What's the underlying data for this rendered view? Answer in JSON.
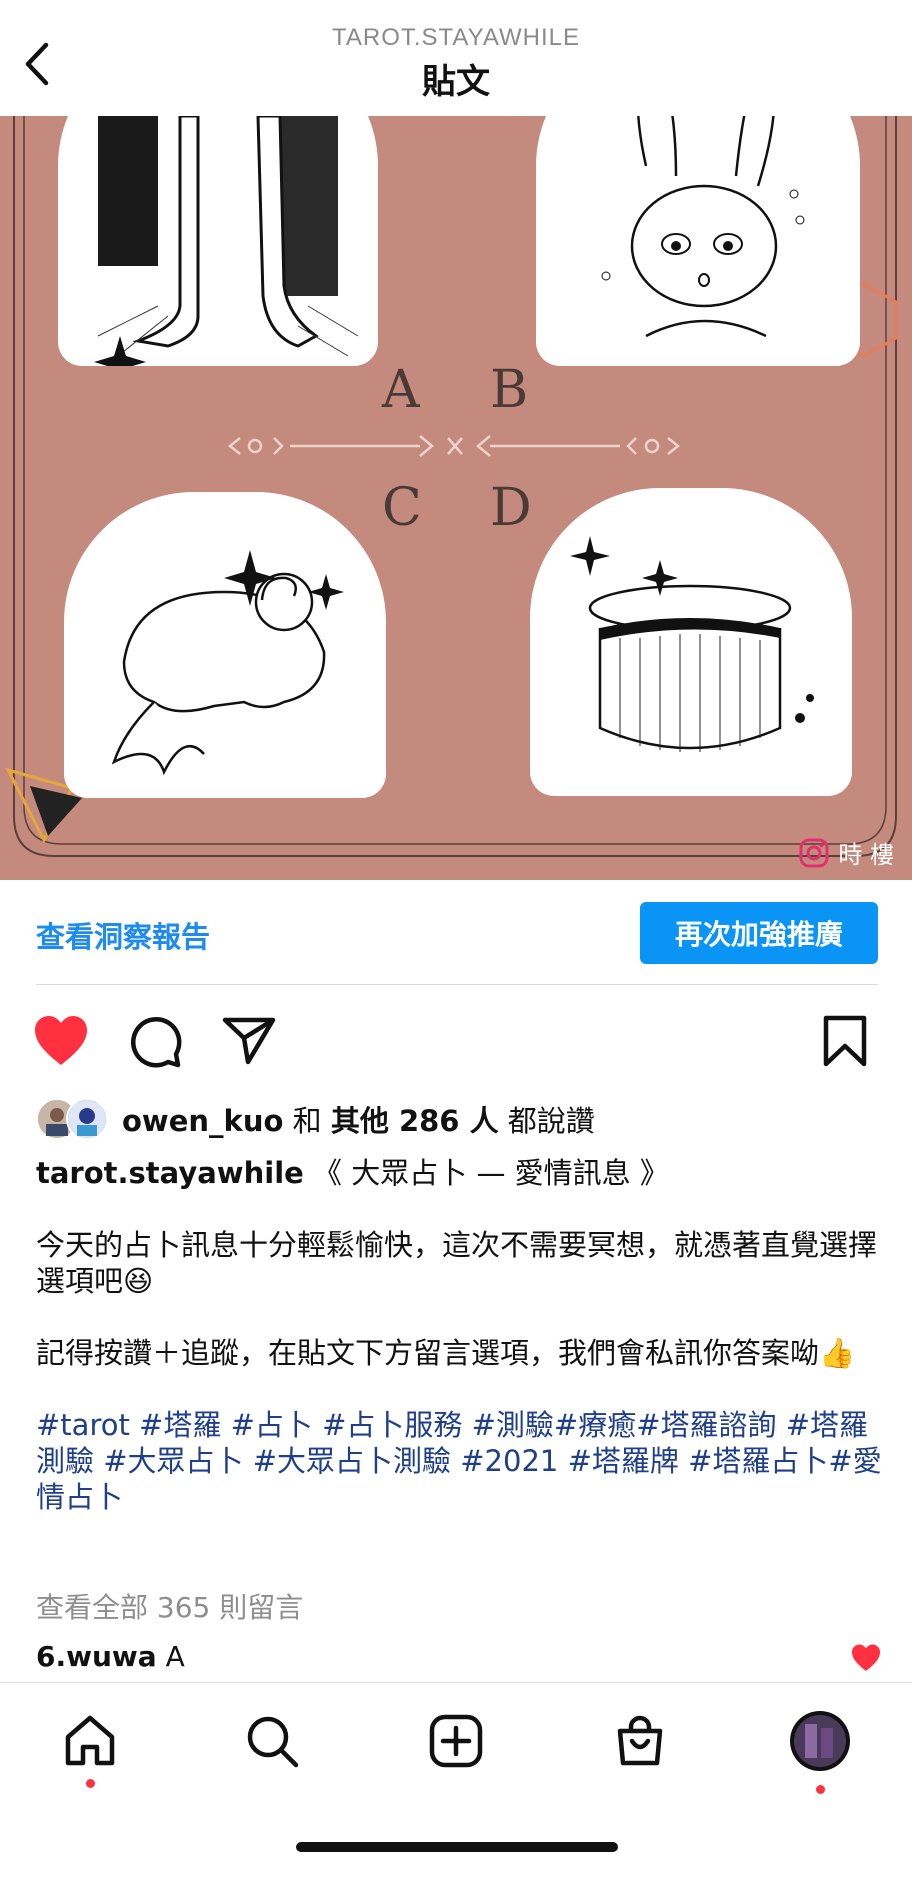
{
  "header": {
    "account": "TAROT.STAYAWHILE",
    "title": "貼文"
  },
  "post_image": {
    "letters": [
      "A",
      "B",
      "C",
      "D"
    ],
    "watermark": "時 樓"
  },
  "insights": {
    "link_label": "查看洞察報告",
    "boost_label": "再次加強推廣"
  },
  "likes": {
    "user": "owen_kuo",
    "connector": "和",
    "others": "其他 286 人",
    "suffix": "都說讚"
  },
  "caption": {
    "username": "tarot.stayawhile",
    "title": "《 大眾占卜 — 愛情訊息 》",
    "para1": "今天的占卜訊息十分輕鬆愉快，這次不需要冥想，就憑著直覺選擇選項吧😆",
    "para2": "記得按讚＋追蹤，在貼文下方留言選項，我們會私訊你答案呦👍",
    "hashtags": "#tarot #塔羅 #占卜 #占卜服務 #測驗#療癒#塔羅諮詢  #塔羅測驗 #大眾占卜 #大眾占卜測驗 #2021 #塔羅牌 #塔羅占卜#愛情占卜"
  },
  "comments": {
    "view_all": "查看全部 365 則留言",
    "first": {
      "user": "6.wuwa",
      "text": "A"
    }
  },
  "nav": {
    "items": [
      "home-icon",
      "search-icon",
      "create-icon",
      "shop-icon",
      "profile-avatar"
    ]
  },
  "colors": {
    "post_bg": "#c48a7e",
    "accent_blue": "#0a95f6",
    "like_red": "#ff3040",
    "hashtag": "#1f3f8a"
  }
}
